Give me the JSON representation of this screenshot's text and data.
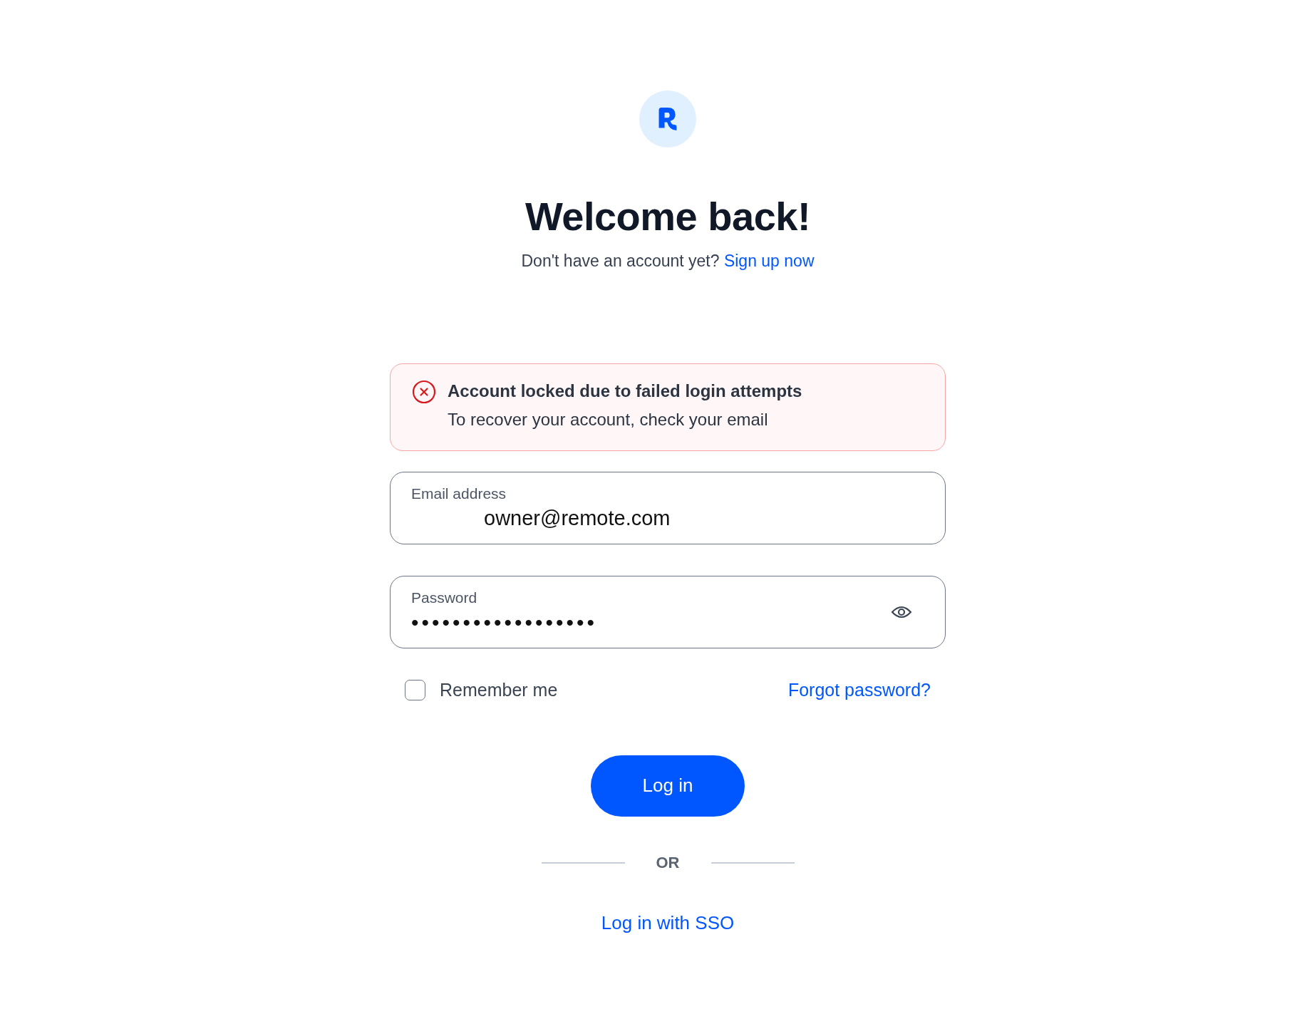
{
  "header": {
    "title": "Welcome back!",
    "prompt": "Don't have an account yet?",
    "signup_link": "Sign up now"
  },
  "alert": {
    "title": "Account locked due to failed login attempts",
    "message": "To recover your account, check your email"
  },
  "email": {
    "label": "Email address",
    "value": "owner@remote.com"
  },
  "password": {
    "label": "Password",
    "value": "••••••••••••••••••"
  },
  "remember": {
    "label": "Remember me",
    "checked": false
  },
  "forgot_link": "Forgot password?",
  "login_button": "Log in",
  "divider": "OR",
  "sso_link": "Log in with SSO"
}
